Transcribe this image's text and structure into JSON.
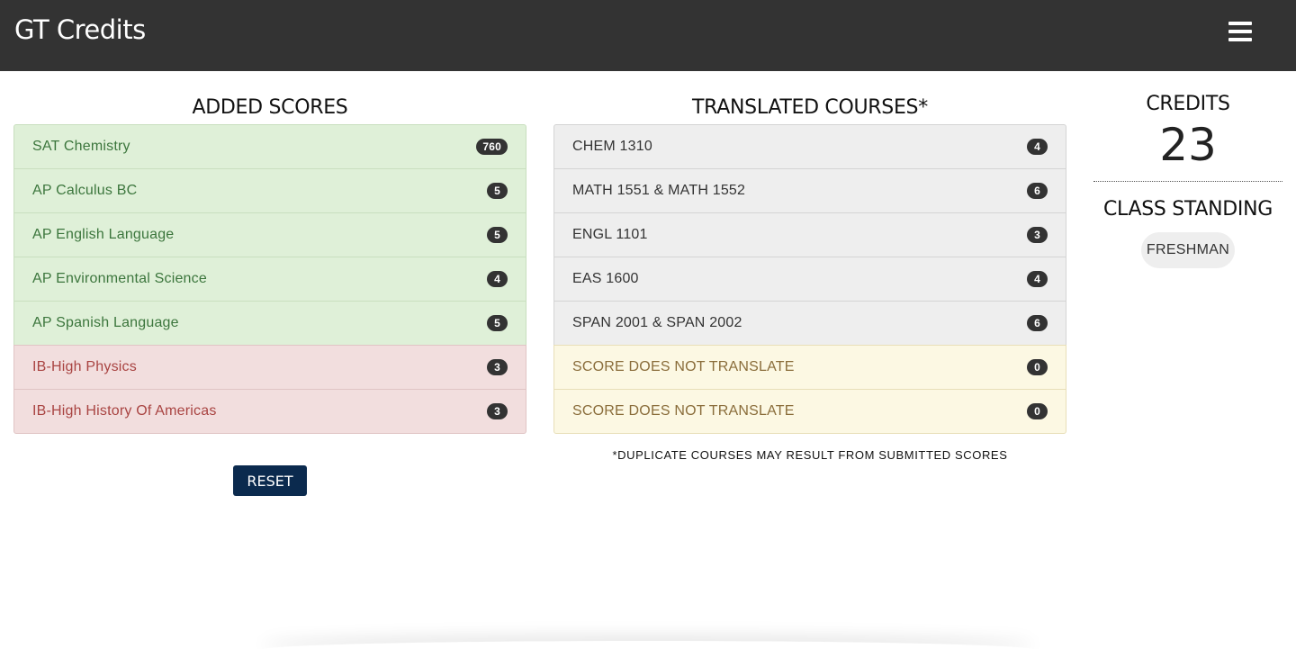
{
  "header": {
    "brand": "GT Credits",
    "menu_icon": "hamburger-menu-icon"
  },
  "added_scores": {
    "title": "ADDED SCORES",
    "items": [
      {
        "name": "SAT Chemistry",
        "score": "760",
        "status": "green"
      },
      {
        "name": "AP Calculus BC",
        "score": "5",
        "status": "green"
      },
      {
        "name": "AP English Language",
        "score": "5",
        "status": "green"
      },
      {
        "name": "AP Environmental Science",
        "score": "4",
        "status": "green"
      },
      {
        "name": "AP Spanish Language",
        "score": "5",
        "status": "green"
      },
      {
        "name": "IB-High Physics",
        "score": "3",
        "status": "red"
      },
      {
        "name": "IB-High History Of Americas",
        "score": "3",
        "status": "red"
      }
    ],
    "reset_label": "RESET"
  },
  "translated_courses": {
    "title": "TRANSLATED COURSES*",
    "items": [
      {
        "course": "CHEM 1310",
        "credits": "4",
        "status": "gray"
      },
      {
        "course": "MATH 1551 & MATH 1552",
        "credits": "6",
        "status": "gray"
      },
      {
        "course": "ENGL 1101",
        "credits": "3",
        "status": "gray"
      },
      {
        "course": "EAS 1600",
        "credits": "4",
        "status": "gray"
      },
      {
        "course": "SPAN 2001 & SPAN 2002",
        "credits": "6",
        "status": "gray"
      },
      {
        "course": "SCORE DOES NOT TRANSLATE",
        "credits": "0",
        "status": "yellow"
      },
      {
        "course": "SCORE DOES NOT TRANSLATE",
        "credits": "0",
        "status": "yellow"
      }
    ],
    "footnote": "*DUPLICATE COURSES MAY RESULT FROM SUBMITTED SCORES"
  },
  "summary": {
    "credits_label": "CREDITS",
    "credits_value": "23",
    "standing_label": "CLASS STANDING",
    "standing_value": "FRESHMAN"
  },
  "colors": {
    "topbar": "#333333",
    "reset_button": "#0b2a4e",
    "success_bg": "#dff0d8",
    "danger_bg": "#f2dede",
    "neutral_bg": "#eeeeee",
    "warning_bg": "#fcf8e3"
  }
}
